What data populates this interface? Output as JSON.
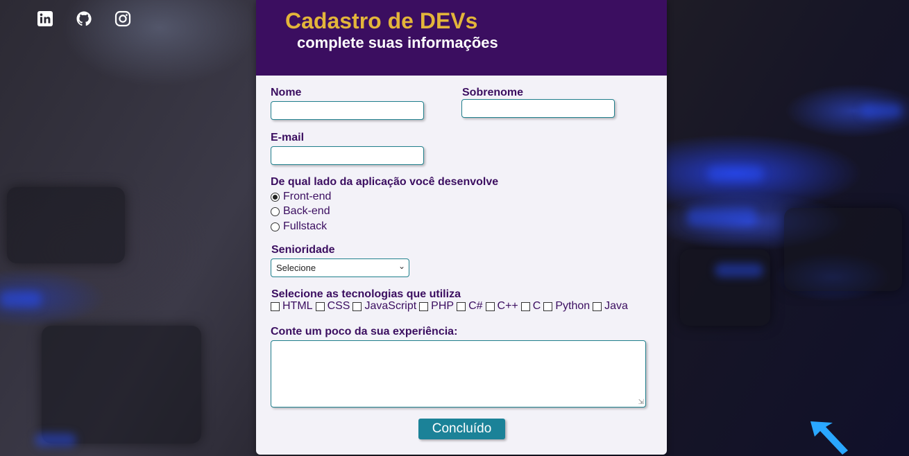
{
  "header": {
    "title": "Cadastro de DEVs",
    "subtitle": "complete suas informações"
  },
  "social": [
    {
      "icon": "linkedin-icon"
    },
    {
      "icon": "github-icon"
    },
    {
      "icon": "instagram-icon"
    }
  ],
  "form": {
    "nome_label": "Nome",
    "nome_value": "",
    "sobrenome_label": "Sobrenome",
    "sobrenome_value": "",
    "email_label": "E-mail",
    "email_value": "",
    "lado_label": "De qual lado da aplicação você desenvolve",
    "lado_options": [
      "Front-end",
      "Back-end",
      "Fullstack"
    ],
    "lado_selected": "Front-end",
    "senioridade_label": "Senioridade",
    "senioridade_value": "Selecione",
    "tecnologias_label": "Selecione as tecnologias que utiliza",
    "tecnologias": [
      "HTML",
      "CSS",
      "JavaScript",
      "PHP",
      "C#",
      "C++",
      "C",
      "Python",
      "Java"
    ],
    "experiencia_label": "Conte um poco da sua experiência:",
    "experiencia_value": "",
    "submit_label": "Concluído"
  },
  "colors": {
    "header_bg": "#3b0e60",
    "title": "#e3b53a",
    "button": "#1b8298"
  }
}
